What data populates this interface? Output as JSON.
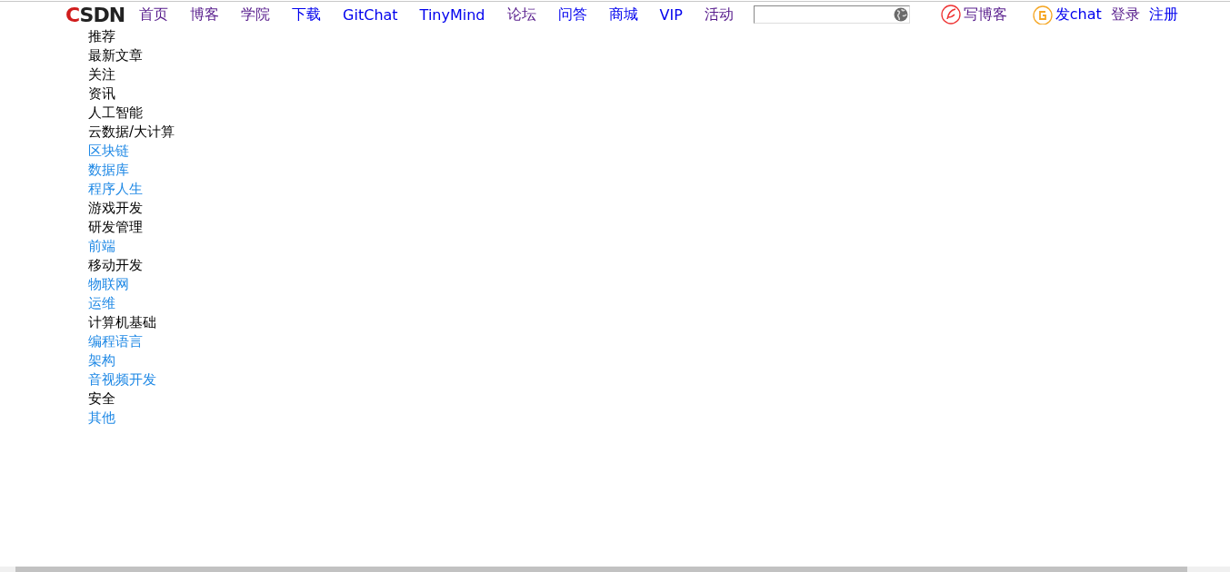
{
  "header": {
    "logo": "CSDN",
    "nav": [
      {
        "label": "首页",
        "visited": true
      },
      {
        "label": "博客",
        "visited": true
      },
      {
        "label": "学院",
        "visited": true
      },
      {
        "label": "下载",
        "visited": false
      },
      {
        "label": "GitChat",
        "visited": false
      },
      {
        "label": "TinyMind",
        "visited": false
      },
      {
        "label": "论坛",
        "visited": true
      },
      {
        "label": "问答",
        "visited": false
      },
      {
        "label": "商城",
        "visited": false
      },
      {
        "label": "VIP",
        "visited": false
      },
      {
        "label": "活动",
        "visited": true
      }
    ],
    "write_blog": {
      "label": "写博客",
      "visited": true
    },
    "post_chat": {
      "label": "发chat",
      "visited": false
    },
    "account": [
      {
        "label": "登录",
        "visited": true
      },
      {
        "label": "注册",
        "visited": false
      }
    ]
  },
  "sidebar": {
    "items": [
      {
        "label": "推荐",
        "highlighted": false
      },
      {
        "label": "最新文章",
        "highlighted": false
      },
      {
        "label": "关注",
        "highlighted": false
      },
      {
        "label": "资讯",
        "highlighted": false
      },
      {
        "label": "人工智能",
        "highlighted": false
      },
      {
        "label": "云数据/大计算",
        "highlighted": false
      },
      {
        "label": "区块链",
        "highlighted": true
      },
      {
        "label": "数据库",
        "highlighted": true
      },
      {
        "label": "程序人生",
        "highlighted": true
      },
      {
        "label": "游戏开发",
        "highlighted": false
      },
      {
        "label": "研发管理",
        "highlighted": false
      },
      {
        "label": "前端",
        "highlighted": true
      },
      {
        "label": "移动开发",
        "highlighted": false
      },
      {
        "label": "物联网",
        "highlighted": true
      },
      {
        "label": "运维",
        "highlighted": true
      },
      {
        "label": "计算机基础",
        "highlighted": false
      },
      {
        "label": "编程语言",
        "highlighted": true
      },
      {
        "label": "架构",
        "highlighted": true
      },
      {
        "label": "音视频开发",
        "highlighted": true
      },
      {
        "label": "安全",
        "highlighted": false
      },
      {
        "label": "其他",
        "highlighted": true
      }
    ]
  }
}
